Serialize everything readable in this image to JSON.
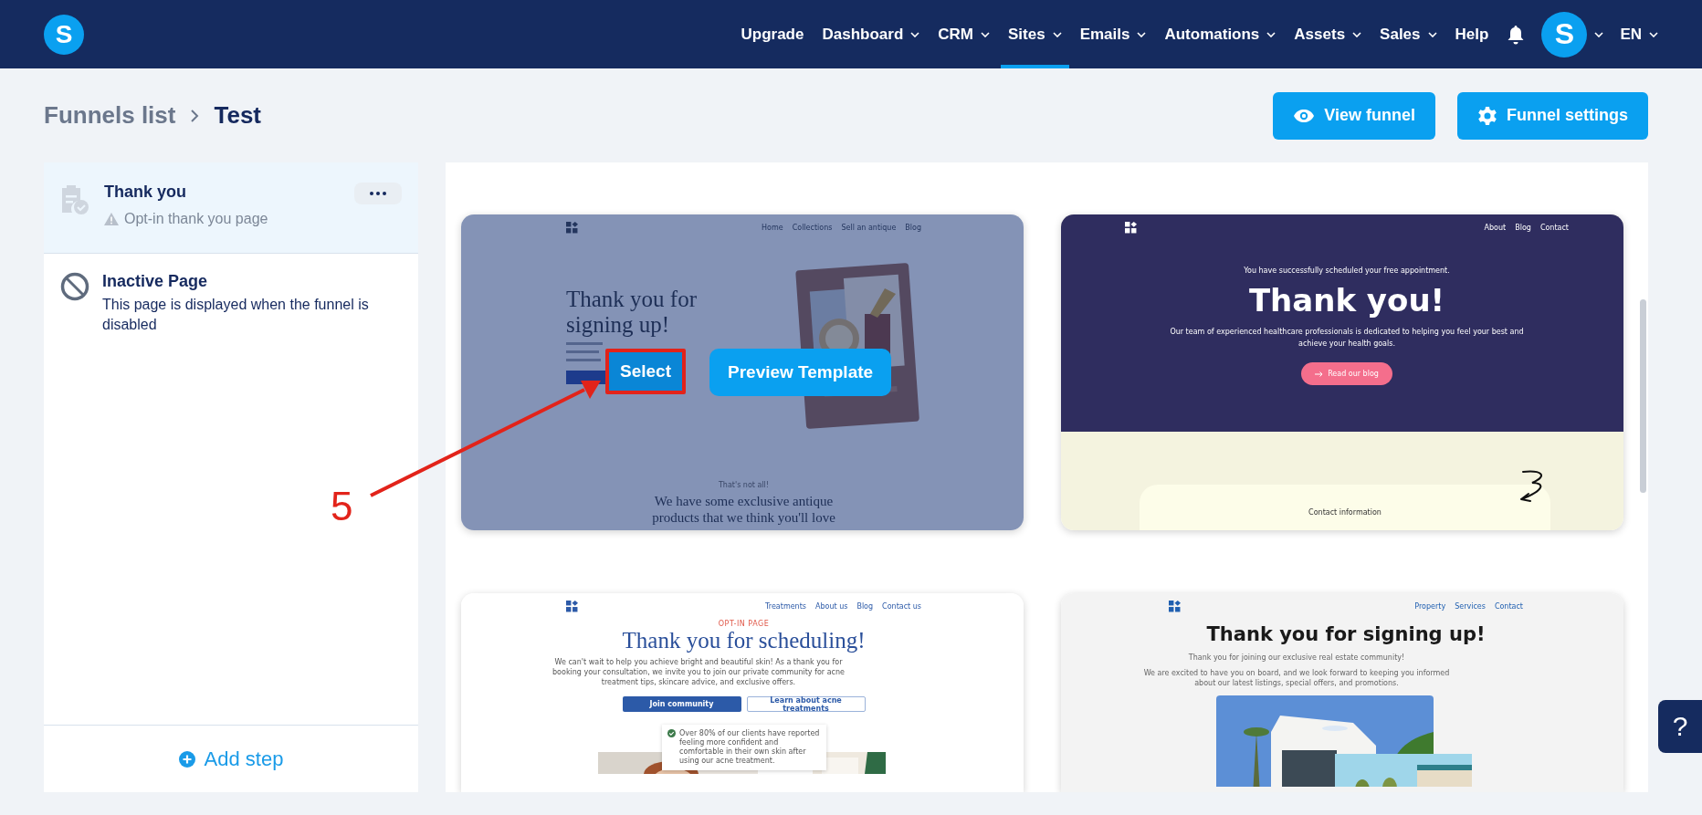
{
  "header": {
    "logo": "S",
    "nav": [
      {
        "label": "Upgrade",
        "dropdown": false,
        "selected": false
      },
      {
        "label": "Dashboard",
        "dropdown": true,
        "selected": false
      },
      {
        "label": "CRM",
        "dropdown": true,
        "selected": false
      },
      {
        "label": "Sites",
        "dropdown": true,
        "selected": true
      },
      {
        "label": "Emails",
        "dropdown": true,
        "selected": false
      },
      {
        "label": "Automations",
        "dropdown": true,
        "selected": false
      },
      {
        "label": "Assets",
        "dropdown": true,
        "selected": false
      },
      {
        "label": "Sales",
        "dropdown": true,
        "selected": false
      },
      {
        "label": "Help",
        "dropdown": false,
        "selected": false
      }
    ],
    "avatar": "S",
    "language": "EN"
  },
  "breadcrumb": [
    {
      "label": "Funnels list",
      "current": false
    },
    {
      "label": "Test",
      "current": true
    }
  ],
  "actions": [
    {
      "label": "View funnel",
      "kind": "eye"
    },
    {
      "label": "Funnel settings",
      "kind": "gear"
    }
  ],
  "steps": [
    {
      "title": "Thank you",
      "subtitle": "Opt-in thank you page",
      "selected": true
    }
  ],
  "inactive": {
    "title": "Inactive Page",
    "description": "This page is displayed when the funnel is disabled"
  },
  "add_step": "Add step",
  "templates": [
    {
      "kind": "antique",
      "nav": [
        "Home",
        "Collections",
        "Sell an antique",
        "Blog"
      ],
      "heading": "Thank you for signing up!",
      "kicker": "That's not all!",
      "subheading": "We have some exclusive antique products that we think you'll love",
      "hover": {
        "select": "Select",
        "preview": "Preview Template"
      }
    },
    {
      "kind": "appointment",
      "nav": [
        "About",
        "Blog",
        "Contact"
      ],
      "kicker": "You have successfully scheduled your free appointment.",
      "heading": "Thank you!",
      "text": "Our team of experienced healthcare professionals is dedicated to helping you feel your best and achieve your health goals.",
      "button": "Read our blog",
      "contact_title": "Contact information"
    },
    {
      "kind": "scheduling",
      "nav": [
        "Treatments",
        "About us",
        "Blog",
        "Contact us"
      ],
      "kicker": "OPT-IN PAGE",
      "heading": "Thank you for scheduling!",
      "text": "We can't wait to help you achieve bright and beautiful skin! As a thank you for booking your consultation, we invite you to join our private community for acne treatment tips, skincare advice, and exclusive offers.",
      "buttons": [
        "Join community",
        "Learn about acne treatments"
      ],
      "testimonial": "Over 80% of our clients have reported feeling more confident and comfortable in their own skin after using our acne treatment."
    },
    {
      "kind": "realestate",
      "nav": [
        "Property",
        "Services",
        "Contact"
      ],
      "heading": "Thank you for signing up!",
      "texts": [
        "Thank you for joining our exclusive real estate community!",
        "We are excited to have you on board, and we look forward to keeping you informed about our latest listings, special offers, and promotions."
      ]
    }
  ],
  "annotation": {
    "label": "5"
  },
  "help": "?"
}
